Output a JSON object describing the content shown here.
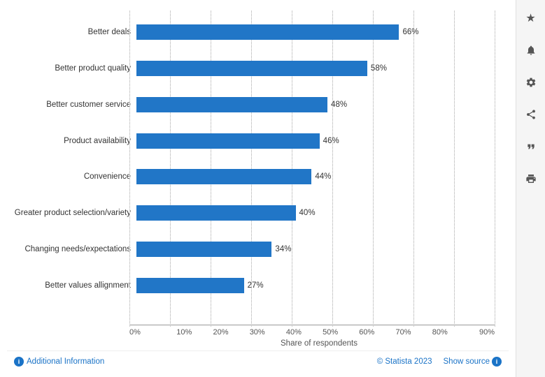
{
  "chart": {
    "bars": [
      {
        "label": "Better deals",
        "value": 66,
        "display": "66%"
      },
      {
        "label": "Better product quality",
        "value": 58,
        "display": "58%"
      },
      {
        "label": "Better customer service",
        "value": 48,
        "display": "48%"
      },
      {
        "label": "Product availability",
        "value": 46,
        "display": "46%"
      },
      {
        "label": "Convenience",
        "value": 44,
        "display": "44%"
      },
      {
        "label": "Greater product selection/variety",
        "value": 40,
        "display": "40%"
      },
      {
        "label": "Changing needs/expectations",
        "value": 34,
        "display": "34%"
      },
      {
        "label": "Better values allignment",
        "value": 27,
        "display": "27%"
      }
    ],
    "x_ticks": [
      "0%",
      "10%",
      "20%",
      "30%",
      "40%",
      "50%",
      "60%",
      "70%",
      "80%",
      "90%"
    ],
    "x_axis_label": "Share of respondents",
    "max_value": 90,
    "bar_color": "#2176c7"
  },
  "footer": {
    "additional_info": "Additional Information",
    "statista_credit": "© Statista 2023",
    "show_source": "Show source"
  },
  "sidebar": {
    "icons": [
      {
        "name": "star-icon",
        "symbol": "★"
      },
      {
        "name": "bell-icon",
        "symbol": "🔔"
      },
      {
        "name": "gear-icon",
        "symbol": "⚙"
      },
      {
        "name": "share-icon",
        "symbol": "⤴"
      },
      {
        "name": "quote-icon",
        "symbol": "❞"
      },
      {
        "name": "print-icon",
        "symbol": "⎙"
      }
    ]
  }
}
